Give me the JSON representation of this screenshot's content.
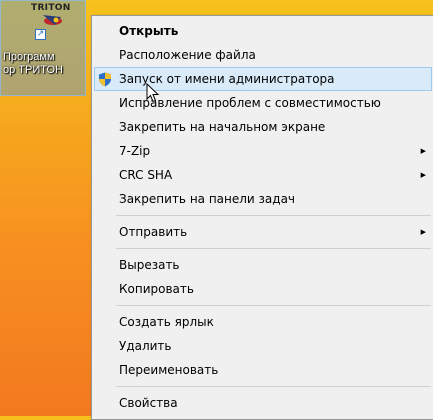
{
  "desktop": {
    "shortcut": {
      "brand": "TRITON",
      "label_line1": "Программ",
      "label_line2": "ор ТРИТОН"
    }
  },
  "context_menu": {
    "groups": [
      [
        {
          "label": "Открыть",
          "bold": true
        },
        {
          "label": "Расположение файла"
        },
        {
          "label": "Запуск от имени администратора",
          "icon": "uac-shield-icon",
          "highlighted": true
        },
        {
          "label": "Исправление проблем с совместимостью"
        },
        {
          "label": "Закрепить на начальном экране"
        },
        {
          "label": "7-Zip",
          "submenu": true
        },
        {
          "label": "CRC SHA",
          "submenu": true
        },
        {
          "label": "Закрепить на панели задач"
        }
      ],
      [
        {
          "label": "Отправить",
          "submenu": true
        }
      ],
      [
        {
          "label": "Вырезать"
        },
        {
          "label": "Копировать"
        }
      ],
      [
        {
          "label": "Создать ярлык"
        },
        {
          "label": "Удалить"
        },
        {
          "label": "Переименовать"
        }
      ],
      [
        {
          "label": "Свойства"
        }
      ]
    ]
  },
  "colors": {
    "menu_background": "#f0f0f0",
    "highlight": "#d9eaf9",
    "highlight_border": "#9fc9ef",
    "desktop_top": "#f6c21b",
    "desktop_bottom": "#f2791f"
  }
}
